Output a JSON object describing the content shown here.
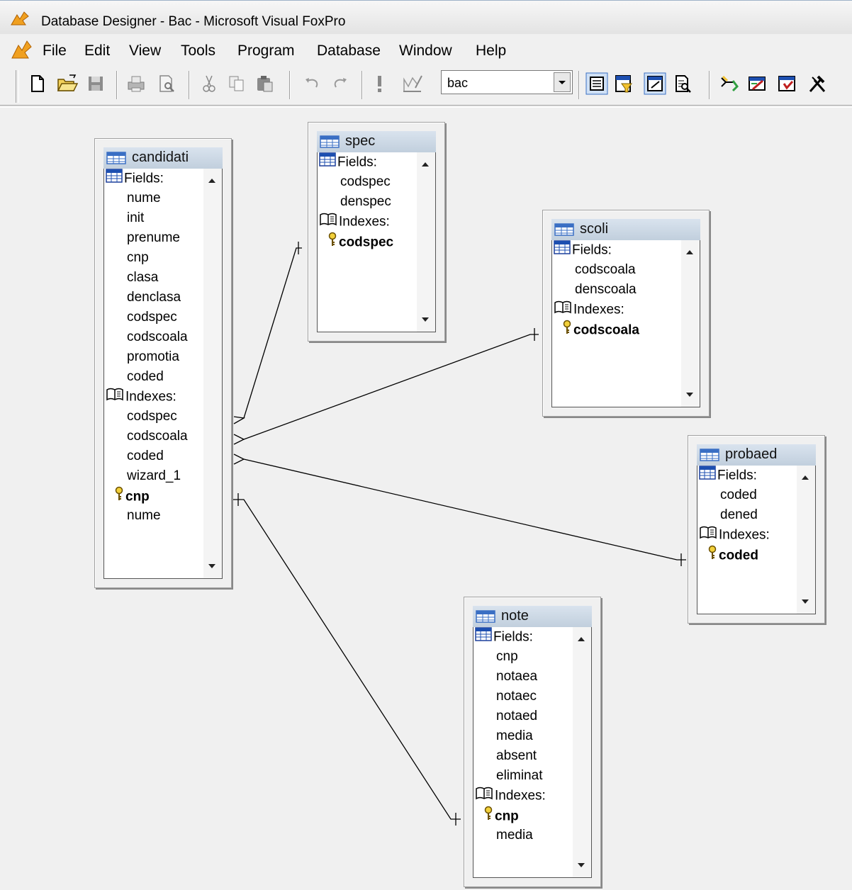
{
  "window": {
    "title": "Database Designer - Bac - Microsoft Visual FoxPro"
  },
  "menu": {
    "items": [
      "File",
      "Edit",
      "View",
      "Tools",
      "Program",
      "Database",
      "Window",
      "Help"
    ]
  },
  "toolbar": {
    "database_combo_value": "bac",
    "buttons": [
      "new-icon",
      "open-icon",
      "save-icon",
      "print-icon",
      "print-preview-icon",
      "cut-icon",
      "copy-icon",
      "paste-icon",
      "undo-icon",
      "redo-icon",
      "run-icon",
      "modify-form-icon",
      "database-designer-icon",
      "filter-icon",
      "properties-icon",
      "browse-icon",
      "relations-icon",
      "edit-table-icon",
      "stored-procedures-icon",
      "tools-icon"
    ]
  },
  "labels": {
    "fields": "Fields:",
    "indexes": "Indexes:"
  },
  "tables": {
    "candidati": {
      "name": "candidati",
      "fields": [
        "nume",
        "init",
        "prenume",
        "cnp",
        "clasa",
        "denclasa",
        "codspec",
        "codscoala",
        "promotia",
        "coded"
      ],
      "indexes": [
        {
          "name": "codspec",
          "primary": false
        },
        {
          "name": "codscoala",
          "primary": false
        },
        {
          "name": "coded",
          "primary": false
        },
        {
          "name": "wizard_1",
          "primary": false
        },
        {
          "name": "cnp",
          "primary": true
        },
        {
          "name": "nume",
          "primary": false
        }
      ]
    },
    "spec": {
      "name": "spec",
      "fields": [
        "codspec",
        "denspec"
      ],
      "indexes": [
        {
          "name": "codspec",
          "primary": true
        }
      ]
    },
    "scoli": {
      "name": "scoli",
      "fields": [
        "codscoala",
        "denscoala"
      ],
      "indexes": [
        {
          "name": "codscoala",
          "primary": true
        }
      ]
    },
    "probaed": {
      "name": "probaed",
      "fields": [
        "coded",
        "dened"
      ],
      "indexes": [
        {
          "name": "coded",
          "primary": true
        }
      ]
    },
    "note": {
      "name": "note",
      "fields": [
        "cnp",
        "notaea",
        "notaec",
        "notaed",
        "media",
        "absent",
        "eliminat"
      ],
      "indexes": [
        {
          "name": "cnp",
          "primary": true
        },
        {
          "name": "media",
          "primary": false
        }
      ]
    }
  },
  "colors": {
    "caption_top": "#d9e3ee",
    "caption_bottom": "#c1cfdd",
    "key_icon": "#c8a200",
    "table_icon": "#3a6fc4"
  }
}
